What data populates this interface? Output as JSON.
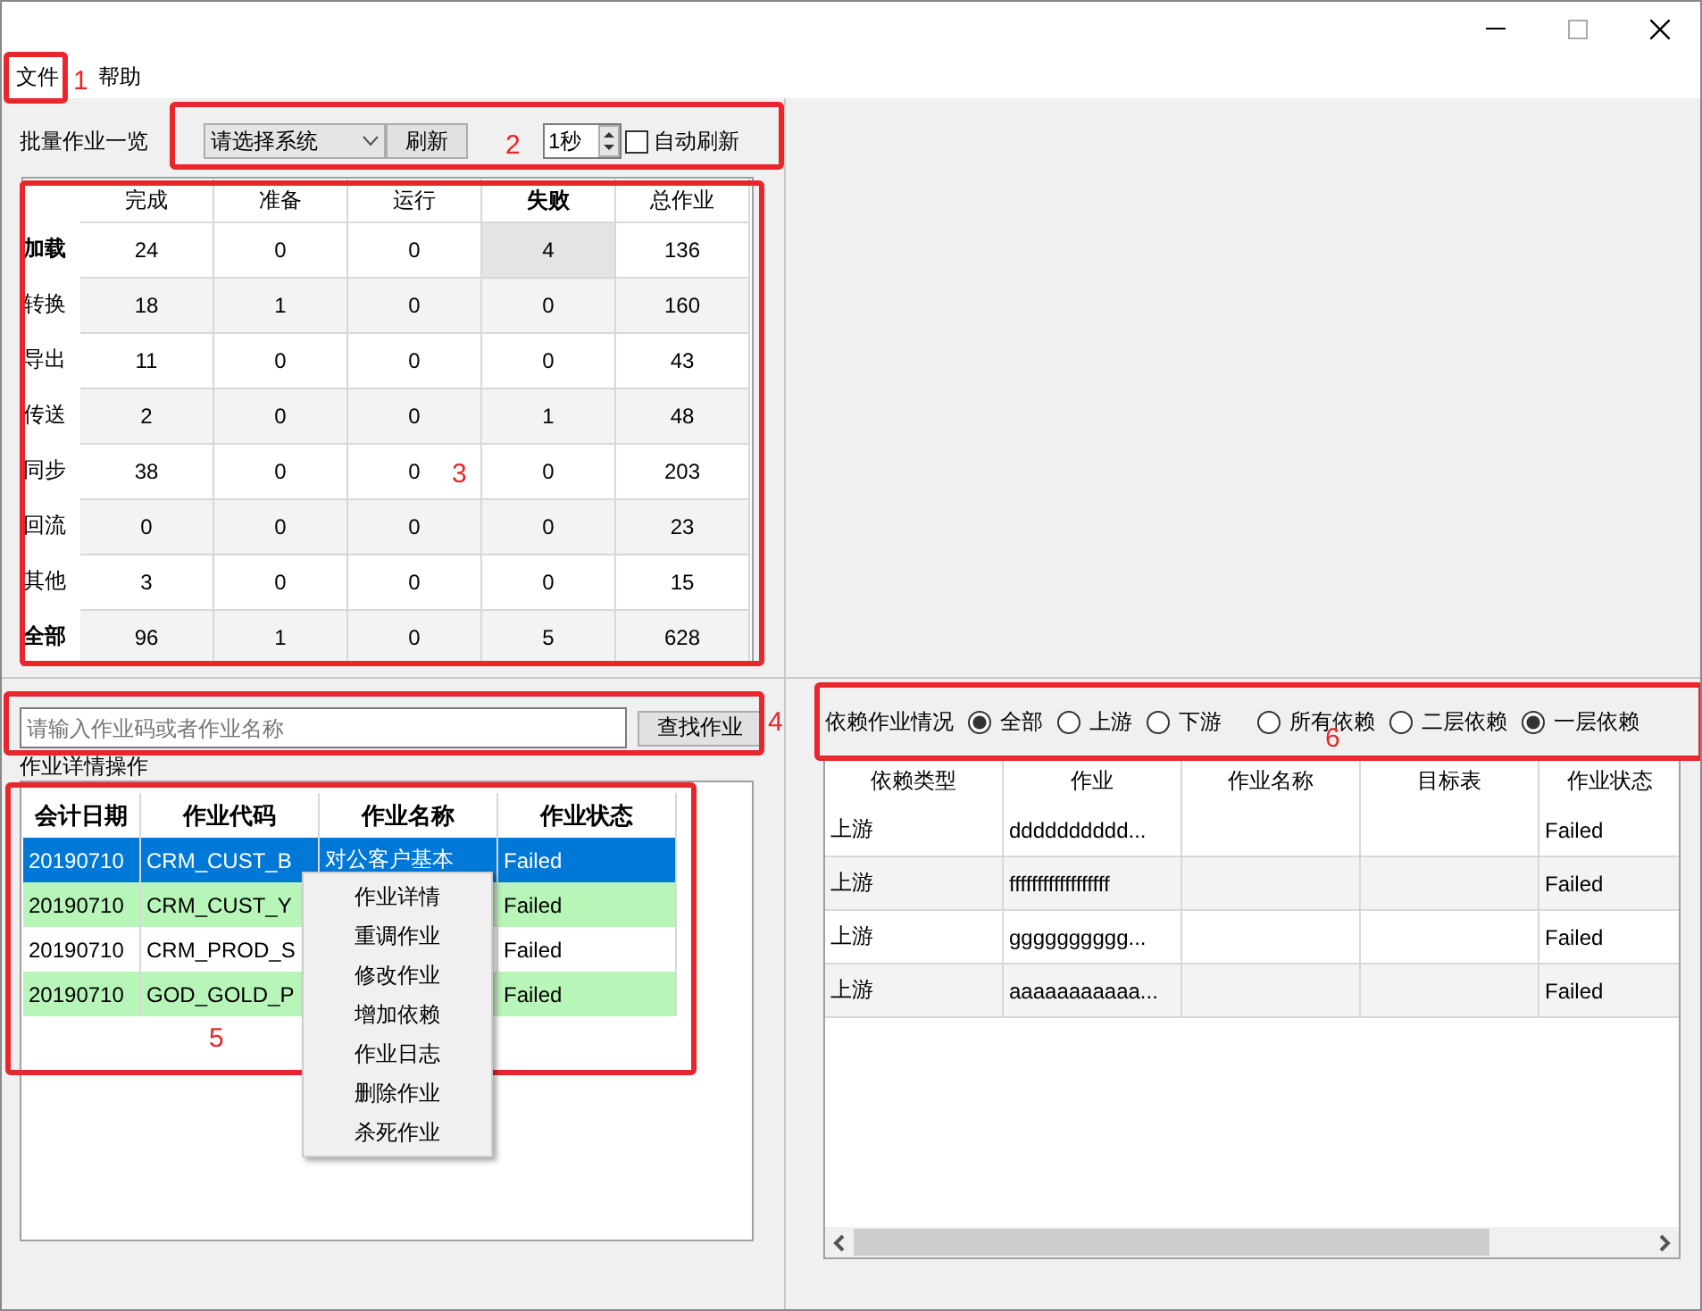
{
  "menu": [
    {
      "label": "文件"
    },
    {
      "label": "帮助"
    }
  ],
  "batch": {
    "title": "批量作业一览",
    "system_select": "请选择系统",
    "refresh_button": "刷新",
    "interval": "1秒",
    "auto_refresh": {
      "label": "自动刷新",
      "checked": false
    }
  },
  "stats": {
    "columns": [
      {
        "label": "完成",
        "selected": false
      },
      {
        "label": "准备",
        "selected": false
      },
      {
        "label": "运行",
        "selected": false
      },
      {
        "label": "失败",
        "selected": true
      },
      {
        "label": "总作业",
        "selected": false
      }
    ],
    "rows": [
      {
        "label": "加载",
        "bold": true,
        "current": true,
        "values": [
          "24",
          "0",
          "0",
          "4",
          "136"
        ]
      },
      {
        "label": "转换",
        "bold": false,
        "current": false,
        "values": [
          "18",
          "1",
          "0",
          "0",
          "160"
        ]
      },
      {
        "label": "导出",
        "bold": false,
        "current": false,
        "values": [
          "11",
          "0",
          "0",
          "0",
          "43"
        ]
      },
      {
        "label": "传送",
        "bold": false,
        "current": false,
        "values": [
          "2",
          "0",
          "0",
          "1",
          "48"
        ]
      },
      {
        "label": "同步",
        "bold": false,
        "current": false,
        "values": [
          "38",
          "0",
          "0",
          "0",
          "203"
        ]
      },
      {
        "label": "回流",
        "bold": false,
        "current": false,
        "values": [
          "0",
          "0",
          "0",
          "0",
          "23"
        ]
      },
      {
        "label": "其他",
        "bold": false,
        "current": false,
        "values": [
          "3",
          "0",
          "0",
          "0",
          "15"
        ]
      },
      {
        "label": "全部",
        "bold": true,
        "current": false,
        "values": [
          "96",
          "1",
          "0",
          "5",
          "628"
        ]
      }
    ]
  },
  "search": {
    "placeholder": "请输入作业码或者作业名称",
    "button": "查找作业"
  },
  "jobs": {
    "group_label": "作业详情操作",
    "columns": [
      "会计日期",
      "作业代码",
      "作业名称",
      "作业状态"
    ],
    "rows": [
      {
        "selected": true,
        "highlighted": false,
        "cells": [
          "20190710",
          "CRM_CUST_B",
          "对公客户基本",
          "Failed"
        ]
      },
      {
        "selected": false,
        "highlighted": true,
        "cells": [
          "20190710",
          "CRM_CUST_Y",
          "",
          "Failed"
        ]
      },
      {
        "selected": false,
        "highlighted": false,
        "cells": [
          "20190710",
          "CRM_PROD_S",
          "",
          "Failed"
        ]
      },
      {
        "selected": false,
        "highlighted": true,
        "cells": [
          "20190710",
          "GOD_GOLD_P",
          "",
          "Failed"
        ]
      }
    ]
  },
  "context_menu": [
    "作业详情",
    "重调作业",
    "修改作业",
    "增加依赖",
    "作业日志",
    "删除作业",
    "杀死作业"
  ],
  "dependencies": {
    "label": "依赖作业情况",
    "direction": [
      {
        "label": "全部",
        "selected": true
      },
      {
        "label": "上游",
        "selected": false
      },
      {
        "label": "下游",
        "selected": false
      }
    ],
    "depth": [
      {
        "label": "所有依赖",
        "selected": false
      },
      {
        "label": "二层依赖",
        "selected": false
      },
      {
        "label": "一层依赖",
        "selected": true
      }
    ],
    "columns": [
      "依赖类型",
      "作业",
      "作业名称",
      "目标表",
      "作业状态"
    ],
    "rows": [
      [
        "上游",
        "dddddddddd...",
        "",
        "",
        "Failed"
      ],
      [
        "上游",
        "ffffffffffffffffff",
        "",
        "",
        "Failed"
      ],
      [
        "上游",
        "gggggggggg...",
        "",
        "",
        "Failed"
      ],
      [
        "上游",
        "aaaaaaaaaaa...",
        "",
        "",
        "Failed"
      ]
    ]
  },
  "annotations": [
    {
      "label": "1"
    },
    {
      "label": "2"
    },
    {
      "label": "3"
    },
    {
      "label": "4"
    },
    {
      "label": "5"
    },
    {
      "label": "6"
    }
  ]
}
